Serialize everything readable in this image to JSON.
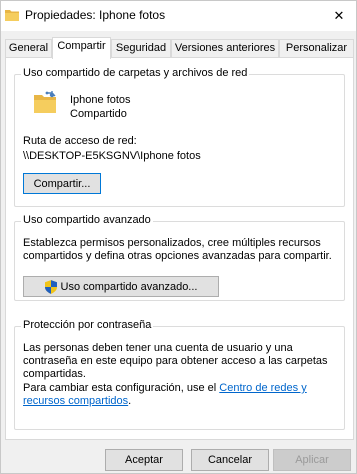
{
  "window": {
    "title": "Propiedades: Iphone fotos",
    "close_glyph": "✕"
  },
  "tabs": [
    {
      "label": "General"
    },
    {
      "label": "Compartir"
    },
    {
      "label": "Seguridad"
    },
    {
      "label": "Versiones anteriores"
    },
    {
      "label": "Personalizar"
    }
  ],
  "network_sharing": {
    "title": "Uso compartido de carpetas y archivos de red",
    "folder_name": "Iphone fotos",
    "status": "Compartido",
    "path_label": "Ruta de acceso de red:",
    "path_value": "\\\\DESKTOP-E5KSGNV\\Iphone fotos",
    "share_button": "Compartir..."
  },
  "advanced_sharing": {
    "title": "Uso compartido avanzado",
    "description_line1": "Establezca permisos personalizados, cree múltiples recursos",
    "description_line2": "compartidos y defina otras opciones avanzadas para compartir.",
    "button": "Uso compartido avanzado..."
  },
  "password_protection": {
    "title": "Protección por contraseña",
    "line1": "Las personas deben tener una cuenta de usuario y una",
    "line2": "contraseña en este equipo para obtener acceso a las carpetas",
    "line3": "compartidas.",
    "line4_prefix": "Para cambiar esta configuración, use el ",
    "link_part1": "Centro de redes y",
    "link_part2": "recursos compartidos",
    "line5_suffix": "."
  },
  "footer": {
    "accept": "Aceptar",
    "cancel": "Cancelar",
    "apply": "Aplicar"
  },
  "colors": {
    "accent": "#0078d7",
    "link": "#0066cc",
    "folder": "#e8b646"
  }
}
